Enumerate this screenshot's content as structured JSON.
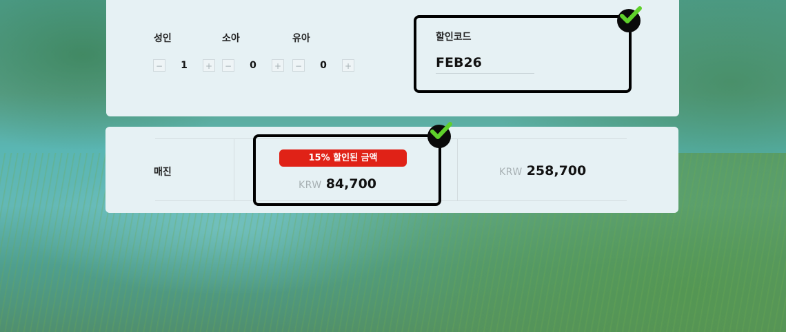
{
  "passengers": [
    {
      "label": "성인",
      "count": "1"
    },
    {
      "label": "소아",
      "count": "0"
    },
    {
      "label": "유아",
      "count": "0"
    }
  ],
  "stepper": {
    "minus": "−",
    "plus": "+"
  },
  "discount": {
    "label": "할인코드",
    "code": "FEB26"
  },
  "fare": {
    "room_type": "매진",
    "badge": "15% 할인된 금액",
    "discounted_currency": "KRW",
    "discounted_amount": "84,700",
    "original_currency": "KRW",
    "original_amount": "258,700"
  },
  "colors": {
    "badge": "#e02217",
    "check": "#5fd12b",
    "highlight_border": "#000000"
  },
  "icons": {
    "check": "check-circle-icon"
  }
}
